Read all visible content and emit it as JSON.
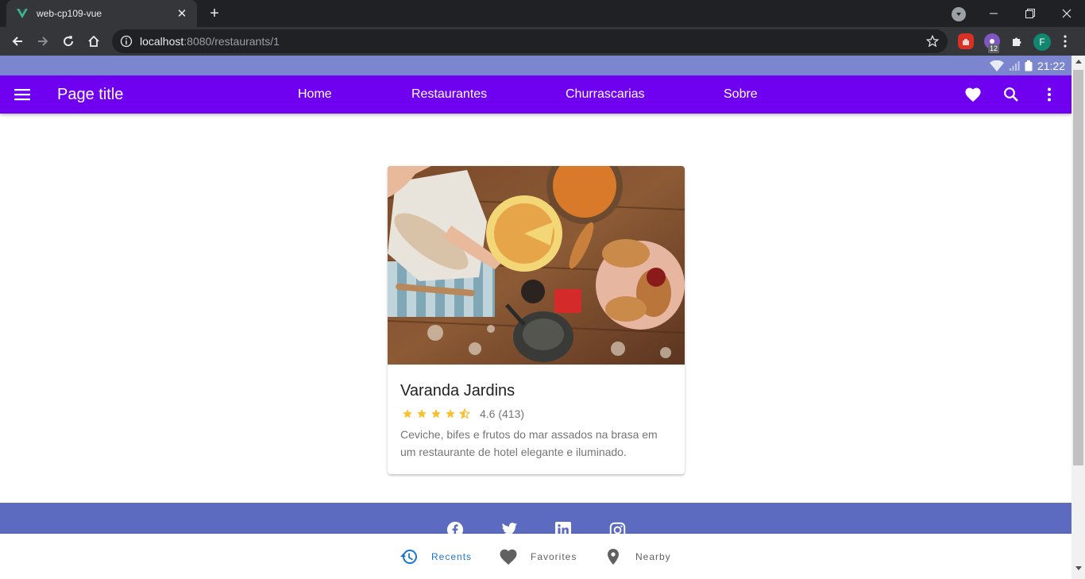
{
  "browser": {
    "tab_title": "web-cp109-vue",
    "url_host": "localhost",
    "url_rest": ":8080/restaurants/1",
    "extension_badge": "12",
    "profile_initial": "F"
  },
  "statusbar": {
    "time": "21:22"
  },
  "appbar": {
    "title": "Page title",
    "nav": [
      {
        "label": "Home"
      },
      {
        "label": "Restaurantes"
      },
      {
        "label": "Churrascarias"
      },
      {
        "label": "Sobre"
      }
    ],
    "colors": {
      "primary": "#7000f0",
      "status": "#7b86cf"
    }
  },
  "card": {
    "title": "Varanda Jardins",
    "rating_value": 4.5,
    "rating_text": "4.6 (413)",
    "description": "Ceviche, bifes e frutos do mar assados na brasa em um restaurante de hotel elegante e iluminado.",
    "image_alt": "food-photo"
  },
  "footer": {
    "color": "#5c6bc0",
    "social_icons": [
      "facebook-icon",
      "twitter-icon",
      "linkedin-icon",
      "instagram-icon"
    ]
  },
  "bottom_nav": {
    "items": [
      {
        "label": "Recents",
        "icon": "history-icon",
        "active": true
      },
      {
        "label": "Favorites",
        "icon": "heart-icon",
        "active": false
      },
      {
        "label": "Nearby",
        "icon": "location-pin-icon",
        "active": false
      }
    ],
    "active_color": "#1976d2"
  }
}
